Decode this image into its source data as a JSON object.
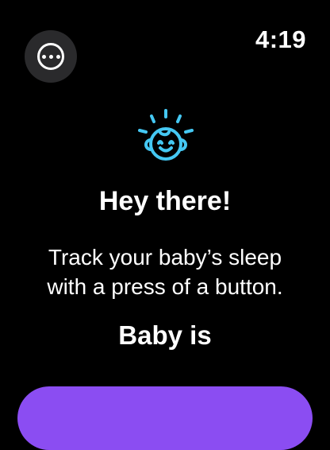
{
  "status_bar": {
    "time": "4:19",
    "more_button_icon": "ellipsis-circle-icon"
  },
  "welcome": {
    "icon": "baby-face-icon",
    "icon_color": "#45c8f3",
    "headline": "Hey there!",
    "description_lines": [
      "Track your baby’s sleep",
      "with a press of a button."
    ],
    "status_label": "Baby is"
  },
  "action_button": {
    "color": "#8b4df2"
  }
}
